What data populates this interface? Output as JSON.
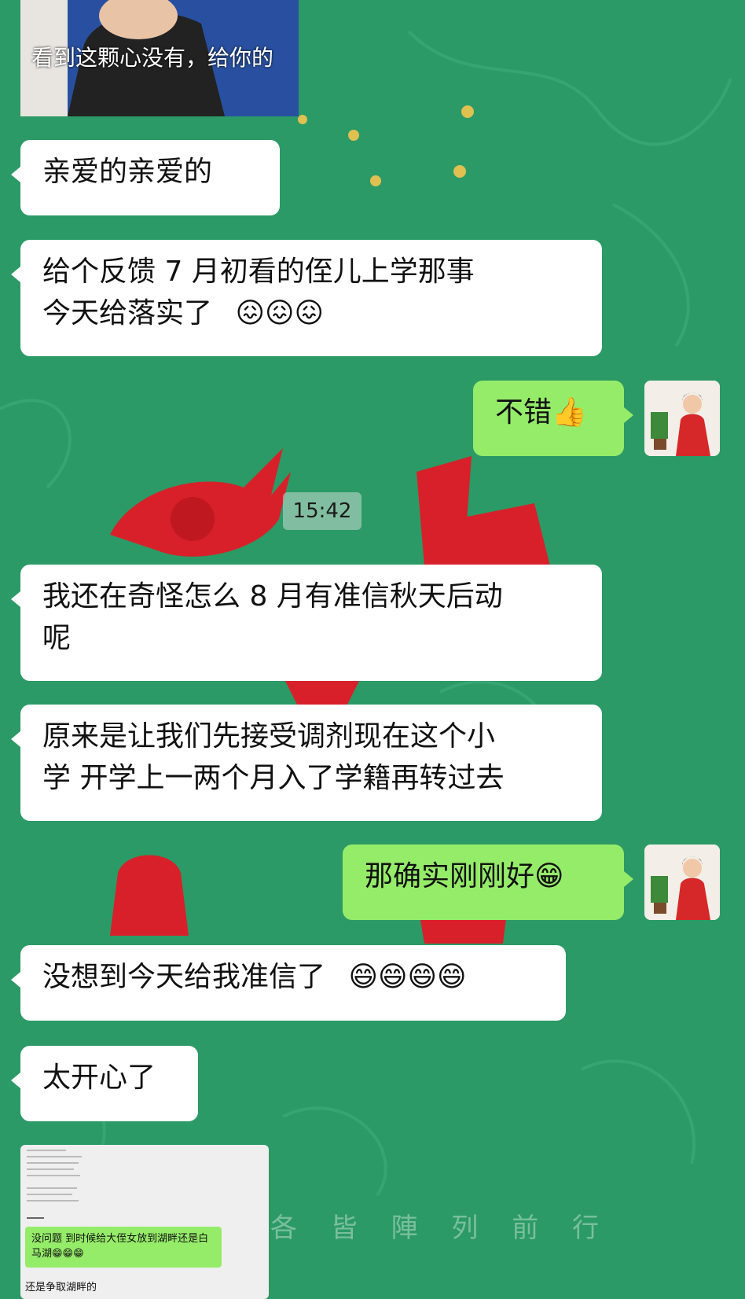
{
  "video": {
    "caption": "看到这颗心没有，给你的"
  },
  "timestamp": "15:42",
  "messages": [
    {
      "side": "left",
      "text": "亲爱的亲爱的"
    },
    {
      "side": "left",
      "line1": "给个反馈  7 月初看的侄儿上学那事",
      "line2": "今天给落实了",
      "emoji": "😖😖😖"
    },
    {
      "side": "right",
      "text": "不错",
      "emoji": "👍"
    },
    {
      "side": "left",
      "line1": "我还在奇怪怎么 8 月有准信秋天后动",
      "line2": "呢"
    },
    {
      "side": "left",
      "line1": "原来是让我们先接受调剂现在这个小",
      "line2": "学  开学上一两个月入了学籍再转过去"
    },
    {
      "side": "right",
      "text": "那确实刚刚好",
      "emoji": "😁"
    },
    {
      "side": "left",
      "text": "没想到今天给我准信了",
      "emoji": "😄😄😄😄"
    },
    {
      "side": "left",
      "text": "太开心了"
    }
  ],
  "image_message": {
    "green_text": "没问题 到时候给大侄女放到湖畔还是白马湖😁😁😁",
    "bottom_text": "还是争取湖畔的"
  },
  "watermark": "各 皆 陣 列 前 行",
  "colors": {
    "background": "#2b9a66",
    "bubble_left": "#ffffff",
    "bubble_right": "#95ec69"
  }
}
